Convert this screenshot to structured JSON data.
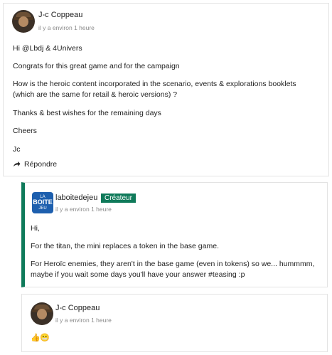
{
  "posts": [
    {
      "author": "J-c Coppeau",
      "time": "il y a environ 1 heure",
      "paragraphs": [
        "Hi @Lbdj & 4Univers",
        "Congrats for this great game and for the campaign",
        "How is the heroic content incorporated in the scenario, events & explorations booklets (which are the same for retail & heroic versions) ?",
        "Thanks & best wishes for the remaining days",
        "Cheers",
        "Jc"
      ],
      "reply_label": "Répondre"
    },
    {
      "author": "laboitedejeu",
      "badge": "Créateur",
      "time": "il y a environ 1 heure",
      "logo": {
        "line1": "LA",
        "line2": "BOITE",
        "line3": "JEU"
      },
      "paragraphs": [
        "Hi,",
        "For the titan, the mini replaces a token in the base game.",
        "For Heroïc enemies, they aren't in the base game (even in tokens) so we... hummmm, maybe if you wait some days you'll have your answer #teasing :p"
      ]
    },
    {
      "author": "J-c Coppeau",
      "time": "il y a environ 1 heure",
      "emojis": [
        "👍",
        "😬"
      ]
    }
  ],
  "colors": {
    "creator_accent": "#0f7a5a",
    "muted_text": "#8a8a8a"
  },
  "icons": {
    "reply": "reply-arrow-icon"
  }
}
